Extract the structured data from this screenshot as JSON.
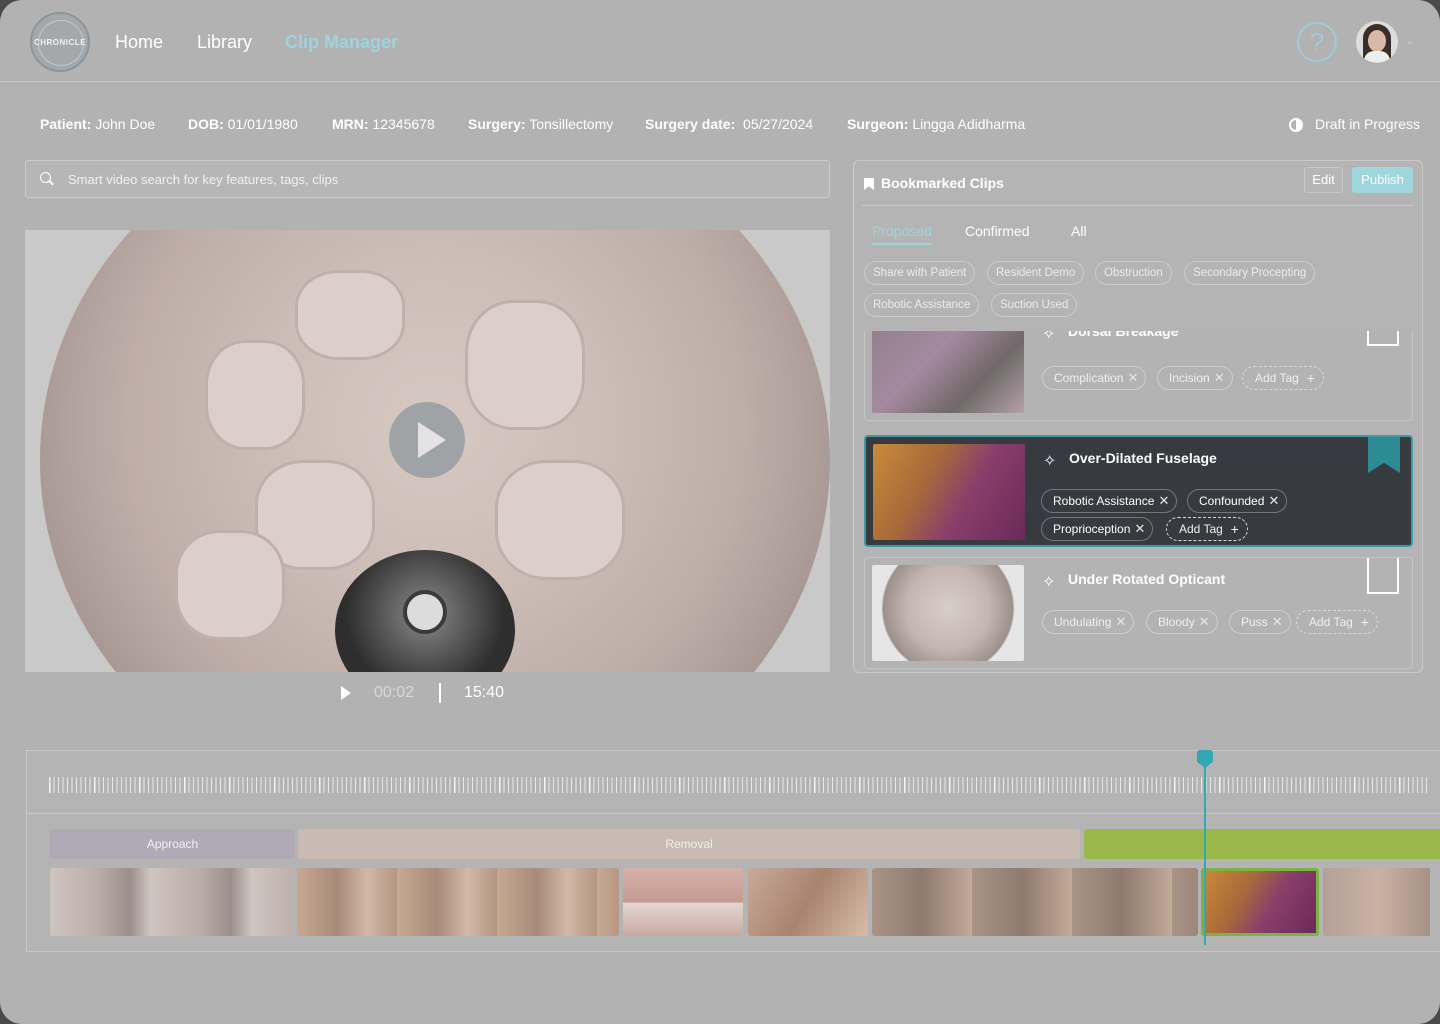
{
  "app": {
    "logo_text": "CHRONICLE"
  },
  "nav": {
    "home": "Home",
    "library": "Library",
    "clip_manager": "Clip Manager"
  },
  "header": {
    "help_glyph": "?"
  },
  "patient": {
    "patient_label": "Patient:",
    "patient_value": " John Doe",
    "dob_label": "DOB:",
    "dob_value": " 01/01/1980",
    "mrn_label": "MRN:",
    "mrn_value": " 12345678",
    "surgery_label": "Surgery:",
    "surgery_value": " Tonsillectomy",
    "surgery_date_label": "Surgery date:",
    "surgery_date_value": "  05/27/2024",
    "surgeon_label": "Surgeon:",
    "surgeon_value": " Lingga Adidharma"
  },
  "status": {
    "draft": "Draft in Progress"
  },
  "search": {
    "placeholder": "Smart video search for key features, tags, clips"
  },
  "player": {
    "current_time": "00:02",
    "total_time": "15:40"
  },
  "bookmarks": {
    "title": "Bookmarked Clips",
    "edit": "Edit",
    "publish": "Publish",
    "tabs": [
      "Proposed",
      "Confirmed",
      "All"
    ],
    "filter_chips": [
      "Share with Patient",
      "Resident Demo",
      "Obstruction",
      "Secondary Procepting",
      "Robotic Assistance",
      "Suction Used"
    ],
    "clips": [
      {
        "title": "Dorsal Breakage",
        "tags": [
          "Complication",
          "Incision"
        ],
        "add_tag": "Add Tag",
        "bookmarked": false
      },
      {
        "title": "Over-Dilated Fuselage",
        "tags": [
          "Robotic Assistance",
          "Confounded",
          "Proprioception"
        ],
        "add_tag": "Add Tag",
        "bookmarked": true
      },
      {
        "title": "Under Rotated Opticant",
        "tags": [
          "Undulating",
          "Bloody",
          "Puss"
        ],
        "add_tag": "Add Tag",
        "bookmarked": false
      }
    ]
  },
  "timeline": {
    "phases": [
      "Approach",
      "Removal",
      ""
    ]
  },
  "colors": {
    "accent": "#9fd3dc",
    "teal": "#2c8b93",
    "green": "#9bb84a"
  }
}
